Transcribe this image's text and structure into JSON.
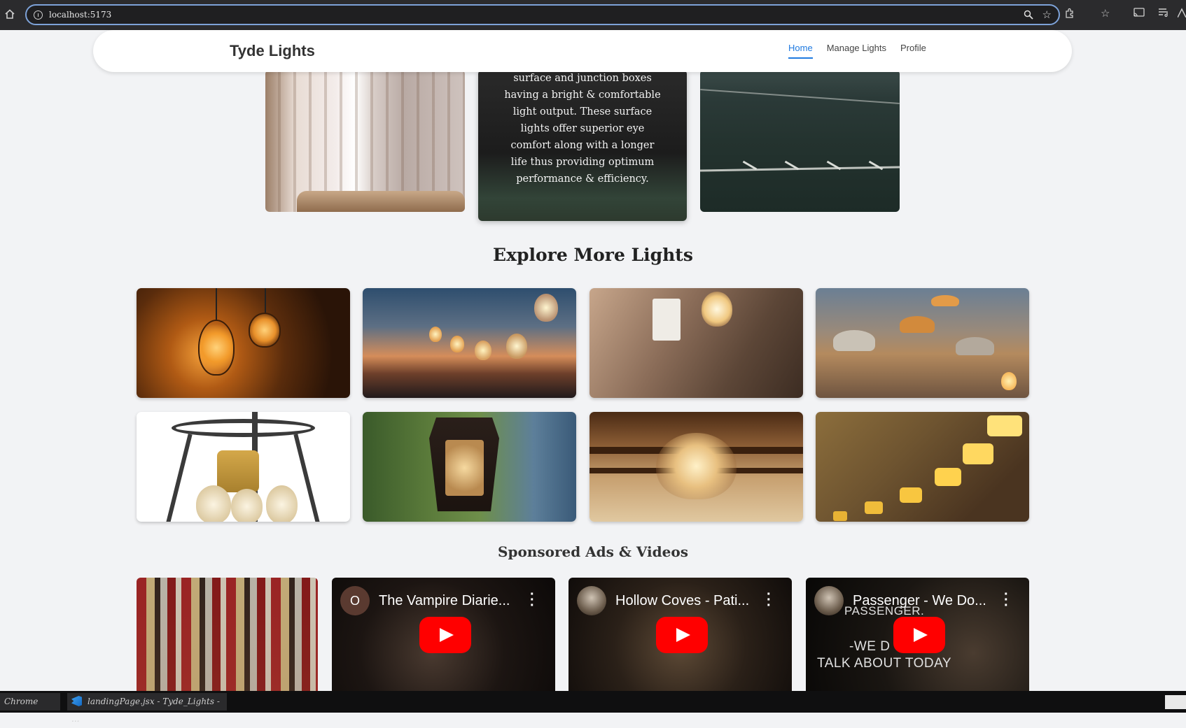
{
  "browser": {
    "url": "localhost:5173"
  },
  "navbar": {
    "brand": "Tyde Lights",
    "links": [
      {
        "label": "Home",
        "active": true
      },
      {
        "label": "Manage Lights",
        "active": false
      },
      {
        "label": "Profile",
        "active": false
      }
    ]
  },
  "top_cards": {
    "description_lines": [
      "surface and junction boxes",
      "having a bright & comfortable",
      "light output. These surface",
      "lights offer superior eye",
      "comfort along with a longer",
      "life thus providing optimum",
      "performance & efficiency."
    ]
  },
  "explore": {
    "title": "Explore More Lights"
  },
  "sponsored": {
    "title": "Sponsored Ads & Videos",
    "videos": [
      {
        "title": "The Vampire Diarie...",
        "avatar_letter": "O"
      },
      {
        "title": "Hollow Coves - Pati...",
        "avatar_letter": ""
      },
      {
        "title": "Passenger - We Do...",
        "avatar_letter": ""
      }
    ],
    "passenger_overlay": {
      "line1": "PASSENGER.",
      "line2": "-WE D",
      "line3": "TALK ABOUT TODAY"
    }
  },
  "taskbar": {
    "items": [
      {
        "label": "Chrome"
      },
      {
        "label": "landingPage.jsx - Tyde_Lights - ..."
      }
    ]
  },
  "colors": {
    "accent": "#1f7ae0",
    "page_background": "#f2f3f5",
    "youtube_red": "#ff0000"
  }
}
